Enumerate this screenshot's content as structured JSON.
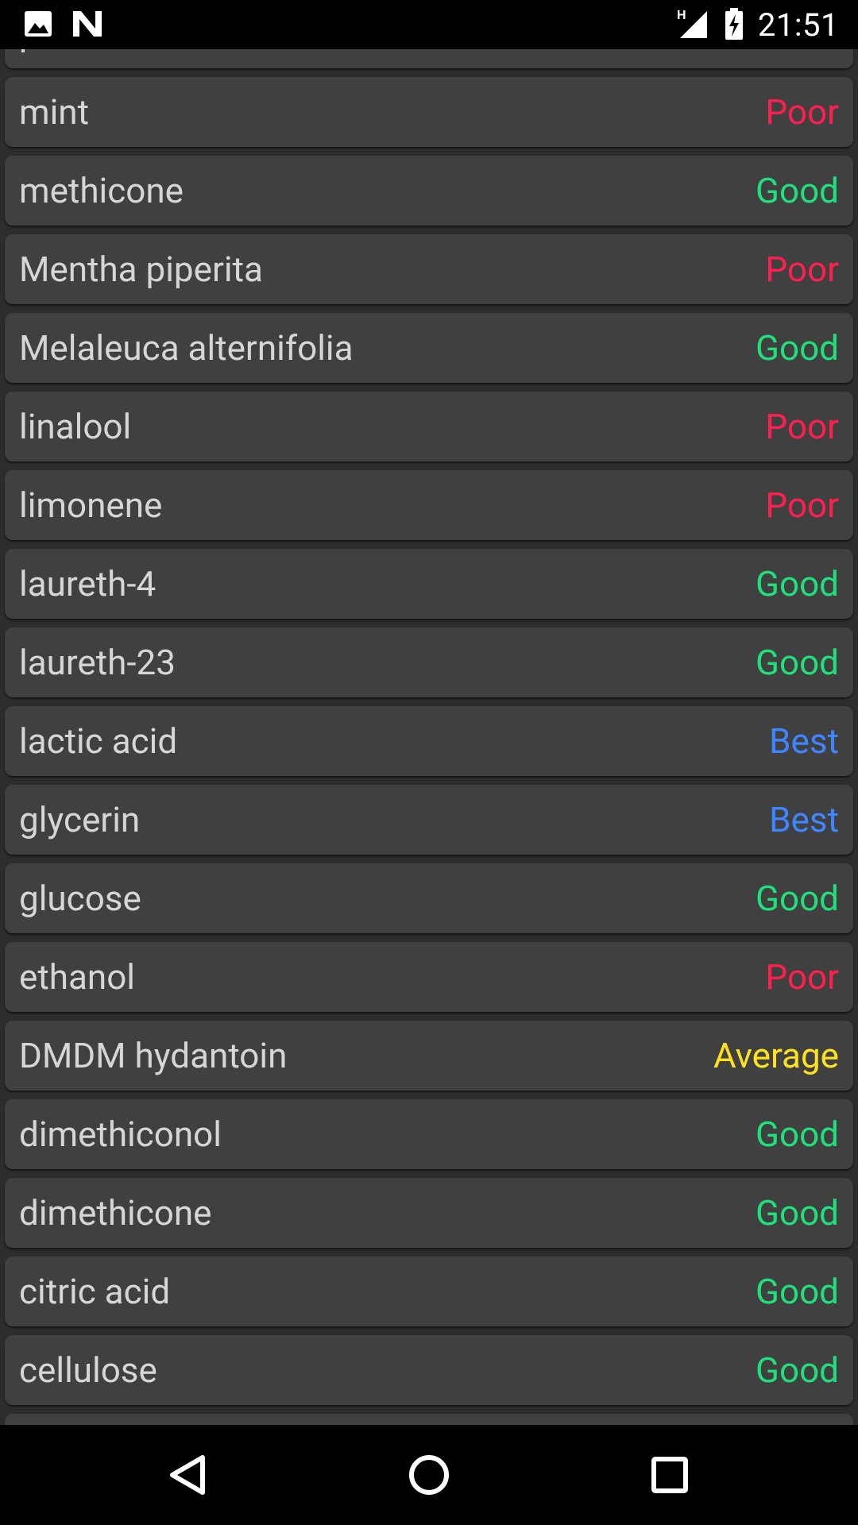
{
  "status_bar": {
    "time": "21:51",
    "network_label": "H",
    "icons": [
      "image-icon",
      "n-logo-icon",
      "signal-icon",
      "battery-charging-icon"
    ]
  },
  "colors": {
    "Poor": "#ff1f4f",
    "Good": "#1fe07a",
    "Best": "#3d86ff",
    "Average": "#ffe21f"
  },
  "ingredients": [
    {
      "name": "p",
      "rating": ""
    },
    {
      "name": "mint",
      "rating": "Poor"
    },
    {
      "name": "methicone",
      "rating": "Good"
    },
    {
      "name": "Mentha piperita",
      "rating": "Poor"
    },
    {
      "name": "Melaleuca alternifolia",
      "rating": "Good"
    },
    {
      "name": "linalool",
      "rating": "Poor"
    },
    {
      "name": "limonene",
      "rating": "Poor"
    },
    {
      "name": "laureth-4",
      "rating": "Good"
    },
    {
      "name": "laureth-23",
      "rating": "Good"
    },
    {
      "name": "lactic acid",
      "rating": "Best"
    },
    {
      "name": "glycerin",
      "rating": "Best"
    },
    {
      "name": "glucose",
      "rating": "Good"
    },
    {
      "name": "ethanol",
      "rating": "Poor"
    },
    {
      "name": "DMDM hydantoin",
      "rating": "Average"
    },
    {
      "name": "dimethiconol",
      "rating": "Good"
    },
    {
      "name": "dimethicone",
      "rating": "Good"
    },
    {
      "name": "citric acid",
      "rating": "Good"
    },
    {
      "name": "cellulose",
      "rating": "Good"
    },
    {
      "name": "",
      "rating": ""
    }
  ],
  "nav_bar": {
    "buttons": [
      "back-icon",
      "home-icon",
      "recents-icon"
    ]
  }
}
